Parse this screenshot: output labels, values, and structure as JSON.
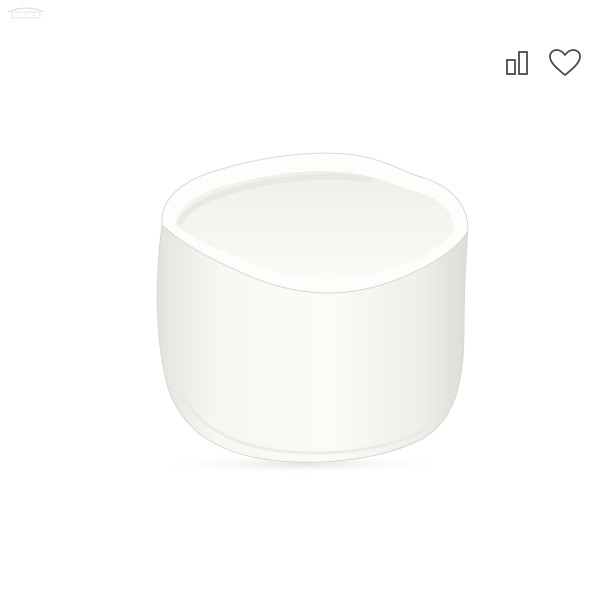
{
  "icons": {
    "corner_logo": "store-logo-icon",
    "compare": "compare-icon",
    "favorite": "heart-icon"
  },
  "colors": {
    "background": "#ffffff",
    "icon_stroke": "#4a4a4a"
  },
  "product": {
    "image": "white-ceramic-bowl"
  }
}
